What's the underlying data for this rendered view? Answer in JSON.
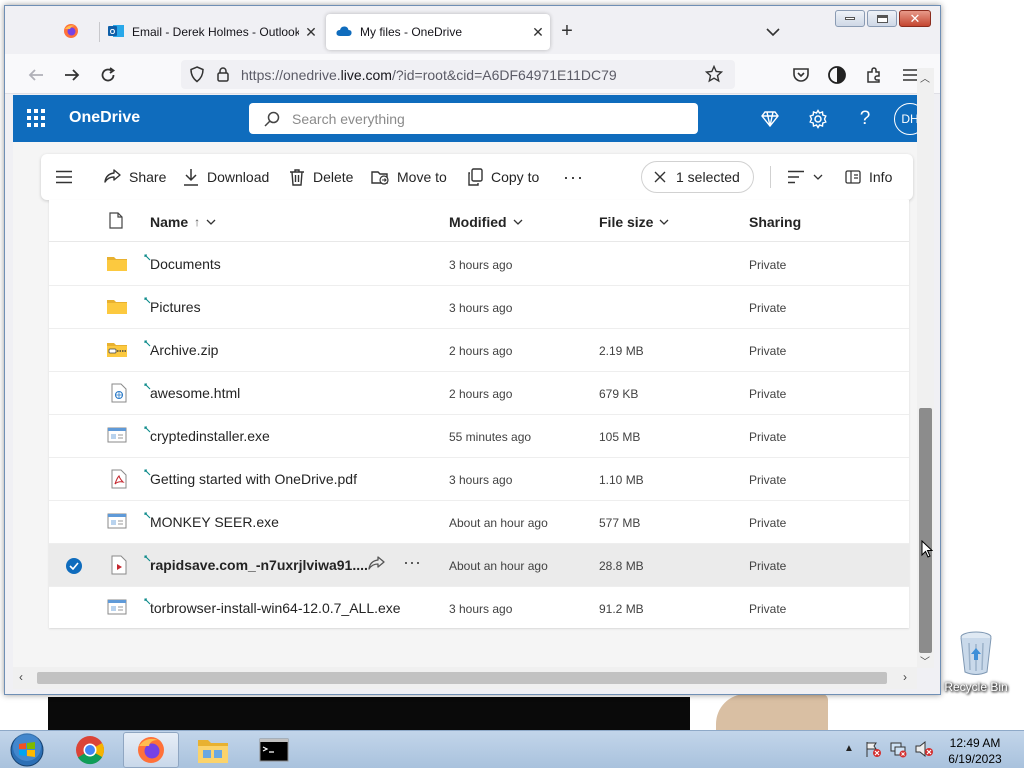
{
  "browser": {
    "tabs": [
      {
        "title": ""
      },
      {
        "title": "Email - Derek Holmes - Outlook"
      },
      {
        "title": "My files - OneDrive"
      }
    ],
    "url_prefix": "https://onedrive.",
    "url_domain": "live.com",
    "url_suffix": "/?id=root&cid=A6DF64971E11DC79"
  },
  "onedrive": {
    "brand": "OneDrive",
    "search_placeholder": "Search everything",
    "avatar_initials": "DH",
    "accent": "#0f6cbd",
    "commands": {
      "share": "Share",
      "download": "Download",
      "delete": "Delete",
      "move_to": "Move to",
      "copy_to": "Copy to",
      "selected": "1 selected",
      "info": "Info"
    },
    "columns": {
      "name": "Name",
      "modified": "Modified",
      "file_size": "File size",
      "sharing": "Sharing"
    },
    "files": [
      {
        "name": "Documents",
        "modified": "3 hours ago",
        "size": "",
        "sharing": "Private",
        "icon": "folder-icon"
      },
      {
        "name": "Pictures",
        "modified": "3 hours ago",
        "size": "",
        "sharing": "Private",
        "icon": "folder-icon"
      },
      {
        "name": "Archive.zip",
        "modified": "2 hours ago",
        "size": "2.19 MB",
        "sharing": "Private",
        "icon": "zip-icon"
      },
      {
        "name": "awesome.html",
        "modified": "2 hours ago",
        "size": "679 KB",
        "sharing": "Private",
        "icon": "html-file-icon"
      },
      {
        "name": "cryptedinstaller.exe",
        "modified": "55 minutes ago",
        "size": "105 MB",
        "sharing": "Private",
        "icon": "exe-file-icon"
      },
      {
        "name": "Getting started with OneDrive.pdf",
        "modified": "3 hours ago",
        "size": "1.10 MB",
        "sharing": "Private",
        "icon": "pdf-file-icon"
      },
      {
        "name": "MONKEY SEER.exe",
        "modified": "About an hour ago",
        "size": "577 MB",
        "sharing": "Private",
        "icon": "exe-file-icon"
      },
      {
        "name": "rapidsave.com_-n7uxrjlviwa91....",
        "modified": "About an hour ago",
        "size": "28.8 MB",
        "sharing": "Private",
        "icon": "video-file-icon"
      },
      {
        "name": "torbrowser-install-win64-12.0.7_ALL.exe",
        "modified": "3 hours ago",
        "size": "91.2 MB",
        "sharing": "Private",
        "icon": "exe-file-icon"
      }
    ]
  },
  "desktop": {
    "recycle_bin_label": "Recycle Bin"
  },
  "taskbar": {
    "time": "12:49 AM",
    "date": "6/19/2023"
  }
}
